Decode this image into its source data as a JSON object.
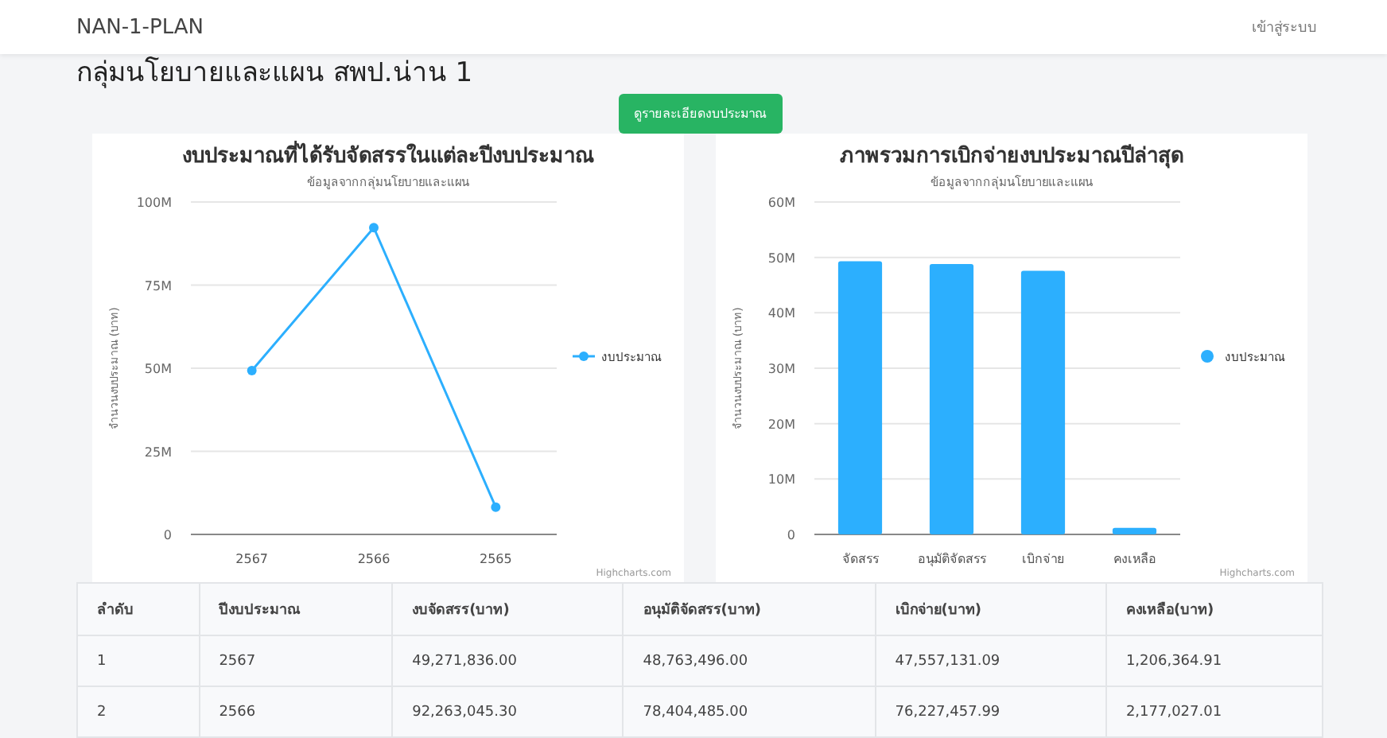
{
  "navbar": {
    "brand": "NAN-1-PLAN",
    "login": "เข้าสู่ระบบ"
  },
  "page_title": "กลุ่มนโยบายและแผน สพป.น่าน 1",
  "detail_button": "ดูรายละเอียดงบประมาณ",
  "charts": [
    {
      "chart_data": {
        "type": "line",
        "title": "งบประมาณที่ได้รับจัดสรรในแต่ละปีงบประมาณ",
        "subtitle": "ข้อมูลจากกลุ่มนโยบายและแผน",
        "ylabel": "จำนวนงบประมาณ (บาท)",
        "categories": [
          "2567",
          "2566",
          "2565"
        ],
        "series": [
          {
            "name": "งบประมาณ",
            "color": "#2caffe",
            "marker": true,
            "values": [
              49300000,
              92300000,
              8200000
            ]
          }
        ],
        "grid": true,
        "ylim": [
          0,
          100000000
        ],
        "yticks": [
          {
            "value": 0,
            "label": "0"
          },
          {
            "value": 25000000,
            "label": "25M"
          },
          {
            "value": 50000000,
            "label": "50M"
          },
          {
            "value": 75000000,
            "label": "75M"
          },
          {
            "value": 100000000,
            "label": "100M"
          }
        ]
      },
      "credits": "Highcharts.com"
    },
    {
      "chart_data": {
        "type": "bar",
        "title": "ภาพรวมการเบิกจ่ายงบประมาณปีล่าสุด",
        "subtitle": "ข้อมูลจากกลุ่มนโยบายและแผน",
        "ylabel": "จำนวนงบประมาณ (บาท)",
        "categories": [
          "จัดสรร",
          "อนุมัติจัดสรร",
          "เบิกจ่าย",
          "คงเหลือ"
        ],
        "series": [
          {
            "name": "งบประมาณ",
            "color": "#2caffe",
            "values": [
              49300000,
              48800000,
              47600000,
              1200000
            ]
          }
        ],
        "grid": true,
        "ylim": [
          0,
          60000000
        ],
        "yticks": [
          {
            "value": 0,
            "label": "0"
          },
          {
            "value": 10000000,
            "label": "10M"
          },
          {
            "value": 20000000,
            "label": "20M"
          },
          {
            "value": 30000000,
            "label": "30M"
          },
          {
            "value": 40000000,
            "label": "40M"
          },
          {
            "value": 50000000,
            "label": "50M"
          },
          {
            "value": 60000000,
            "label": "60M"
          }
        ]
      },
      "credits": "Highcharts.com"
    }
  ],
  "table": {
    "columns": [
      "ลำดับ",
      "ปีงบประมาณ",
      "งบจัดสรร(บาท)",
      "อนุมัติจัดสรร(บาท)",
      "เบิกจ่าย(บาท)",
      "คงเหลือ(บาท)"
    ],
    "rows": [
      [
        "1",
        "2567",
        "49,271,836.00",
        "48,763,496.00",
        "47,557,131.09",
        "1,206,364.91"
      ],
      [
        "2",
        "2566",
        "92,263,045.30",
        "78,404,485.00",
        "76,227,457.99",
        "2,177,027.01"
      ]
    ]
  }
}
